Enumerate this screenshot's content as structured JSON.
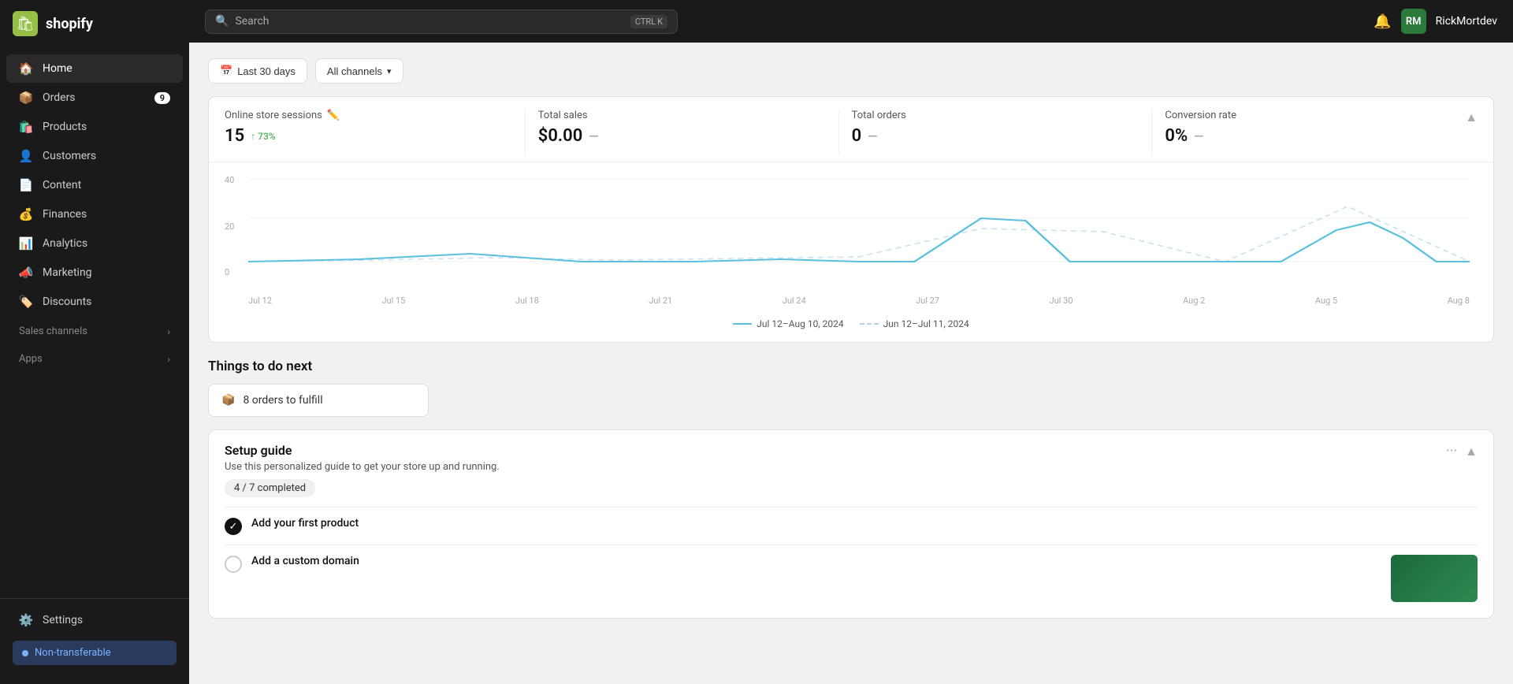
{
  "sidebar": {
    "logo_text": "shopify",
    "nav_items": [
      {
        "id": "home",
        "label": "Home",
        "icon": "🏠",
        "active": true,
        "badge": null
      },
      {
        "id": "orders",
        "label": "Orders",
        "icon": "📦",
        "active": false,
        "badge": "9"
      },
      {
        "id": "products",
        "label": "Products",
        "icon": "🛍️",
        "active": false,
        "badge": null
      },
      {
        "id": "customers",
        "label": "Customers",
        "icon": "👤",
        "active": false,
        "badge": null
      },
      {
        "id": "content",
        "label": "Content",
        "icon": "📄",
        "active": false,
        "badge": null
      },
      {
        "id": "finances",
        "label": "Finances",
        "icon": "💰",
        "active": false,
        "badge": null
      },
      {
        "id": "analytics",
        "label": "Analytics",
        "icon": "📊",
        "active": false,
        "badge": null
      },
      {
        "id": "marketing",
        "label": "Marketing",
        "icon": "📣",
        "active": false,
        "badge": null
      },
      {
        "id": "discounts",
        "label": "Discounts",
        "icon": "🏷️",
        "active": false,
        "badge": null
      }
    ],
    "sales_channels_label": "Sales channels",
    "apps_label": "Apps",
    "settings_label": "Settings",
    "non_transferable_label": "Non-transferable"
  },
  "topbar": {
    "search_placeholder": "Search",
    "shortcut_ctrl": "CTRL",
    "shortcut_key": "K",
    "user_initials": "RM",
    "user_name": "RickMortdev"
  },
  "filters": {
    "date_label": "Last 30 days",
    "channel_label": "All channels"
  },
  "analytics": {
    "sessions_label": "Online store sessions",
    "sessions_value": "15",
    "sessions_change": "↑ 73%",
    "sales_label": "Total sales",
    "sales_value": "$0.00",
    "sales_dash": "—",
    "orders_label": "Total orders",
    "orders_value": "0",
    "orders_dash": "—",
    "conversion_label": "Conversion rate",
    "conversion_value": "0%",
    "conversion_dash": "—",
    "chart_y_labels": [
      "40",
      "20",
      "0"
    ],
    "chart_x_labels": [
      "Jul 12",
      "Jul 15",
      "Jul 18",
      "Jul 21",
      "Jul 24",
      "Jul 27",
      "Jul 30",
      "Aug 2",
      "Aug 5",
      "Aug 8"
    ],
    "legend_current": "Jul 12–Aug 10, 2024",
    "legend_previous": "Jun 12–Jul 11, 2024"
  },
  "things_to_do": {
    "title": "Things to do next",
    "fulfill_label": "8 orders to fulfill"
  },
  "setup_guide": {
    "title": "Setup guide",
    "description": "Use this personalized guide to get your store up and running.",
    "progress": "4 / 7 completed",
    "items": [
      {
        "id": "add-product",
        "label": "Add your first product",
        "completed": true
      },
      {
        "id": "custom-domain",
        "label": "Add a custom domain",
        "completed": false
      }
    ]
  }
}
